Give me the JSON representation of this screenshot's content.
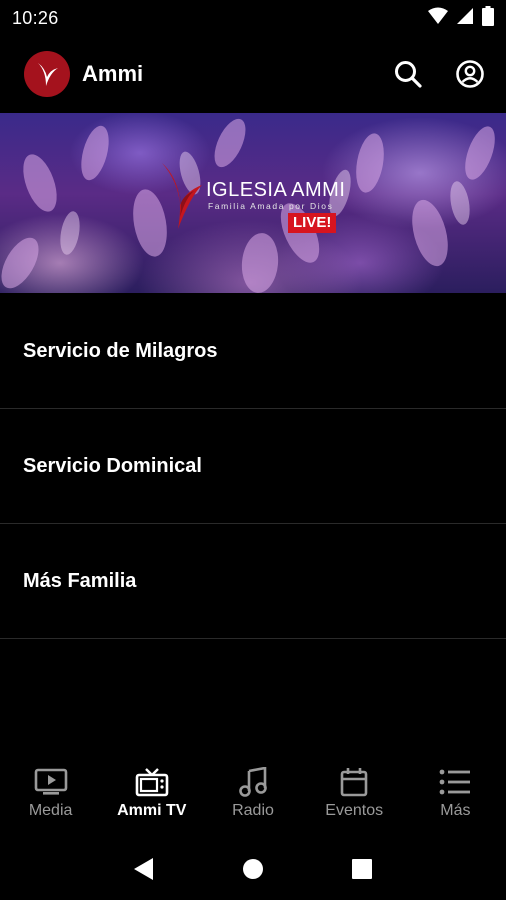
{
  "status_bar": {
    "time": "10:26",
    "icons": [
      "wifi-icon",
      "signal-icon",
      "battery-icon"
    ]
  },
  "app_bar": {
    "title": "Ammi",
    "logo": "ammi-logo",
    "actions": [
      "search-icon",
      "account-icon"
    ]
  },
  "banner": {
    "brand_name": "IGLESIA AMMI",
    "tagline": "Familia Amada por Dios",
    "live_label": "LIVE!"
  },
  "list": {
    "items": [
      {
        "label": "Servicio de Milagros"
      },
      {
        "label": "Servicio Dominical"
      },
      {
        "label": "Más Familia"
      }
    ]
  },
  "bottom_nav": {
    "items": [
      {
        "label": "Media",
        "icon": "media-icon",
        "active": false
      },
      {
        "label": "Ammi TV",
        "icon": "tv-icon",
        "active": true
      },
      {
        "label": "Radio",
        "icon": "music-note-icon",
        "active": false
      },
      {
        "label": "Eventos",
        "icon": "calendar-icon",
        "active": false
      },
      {
        "label": "Más",
        "icon": "list-icon",
        "active": false
      }
    ]
  },
  "colors": {
    "background": "#000000",
    "accent_red": "#a4121d",
    "live_red": "#d7141f",
    "inactive_label": "#9a9a9a"
  }
}
